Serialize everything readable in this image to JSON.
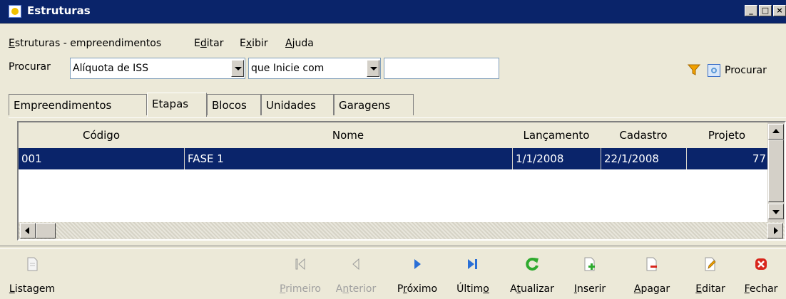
{
  "window": {
    "title": "Estruturas",
    "controls": [
      "_",
      "□",
      "×"
    ]
  },
  "menu": [
    {
      "pre": "",
      "u": "E",
      "post": "struturas - empreendimentos"
    },
    {
      "pre": "E",
      "u": "d",
      "post": "itar"
    },
    {
      "pre": "E",
      "u": "x",
      "post": "ibir"
    },
    {
      "pre": "",
      "u": "A",
      "post": "juda"
    }
  ],
  "search": {
    "label": "Procurar",
    "field_value": "Alíquota de ISS",
    "condition_value": "que Inicie com",
    "text_value": "",
    "search_button_label": "Procurar",
    "filter_icon": "funnel-icon",
    "search_icon": "search-window-icon"
  },
  "tabs": [
    {
      "label": "Empreendimentos",
      "active": false
    },
    {
      "label": "Etapas",
      "active": true
    },
    {
      "label": "Blocos",
      "active": false
    },
    {
      "label": "Unidades",
      "active": false
    },
    {
      "label": "Garagens",
      "active": false
    }
  ],
  "grid": {
    "columns": [
      "Código",
      "Nome",
      "Lançamento",
      "Cadastro",
      "Projeto"
    ],
    "rows": [
      {
        "codigo": "001",
        "nome": "FASE 1",
        "lancamento": "1/1/2008",
        "cadastro": "22/1/2008",
        "projeto": "77"
      }
    ]
  },
  "toolbar": [
    {
      "pre": "",
      "u": "L",
      "post": "istagem",
      "icon": "report-icon",
      "enabled": true
    },
    {
      "pre": "",
      "u": "P",
      "post": "rimeiro",
      "icon": "first-record-icon",
      "enabled": false
    },
    {
      "pre": "A",
      "u": "n",
      "post": "terior",
      "icon": "previous-record-icon",
      "enabled": false
    },
    {
      "pre": "P",
      "u": "r",
      "post": "óximo",
      "icon": "next-record-icon",
      "enabled": true
    },
    {
      "pre": "Últim",
      "u": "o",
      "post": "",
      "icon": "last-record-icon",
      "enabled": true
    },
    {
      "pre": "A",
      "u": "t",
      "post": "ualizar",
      "icon": "refresh-icon",
      "enabled": true
    },
    {
      "pre": "",
      "u": "I",
      "post": "nserir",
      "icon": "insert-icon",
      "enabled": true
    },
    {
      "pre": "",
      "u": "A",
      "post": "pagar",
      "icon": "delete-icon",
      "enabled": true
    },
    {
      "pre": "",
      "u": "E",
      "post": "ditar",
      "icon": "edit-icon",
      "enabled": true
    },
    {
      "pre": "",
      "u": "F",
      "post": "echar",
      "icon": "close-icon",
      "enabled": true
    }
  ],
  "colors": {
    "titlebar": "#0a246a",
    "selection": "#0a246a",
    "refresh_green": "#2eaa2e",
    "nav_blue": "#2a6fd6",
    "close_red": "#d8261c",
    "filter_orange": "#f0a000"
  }
}
